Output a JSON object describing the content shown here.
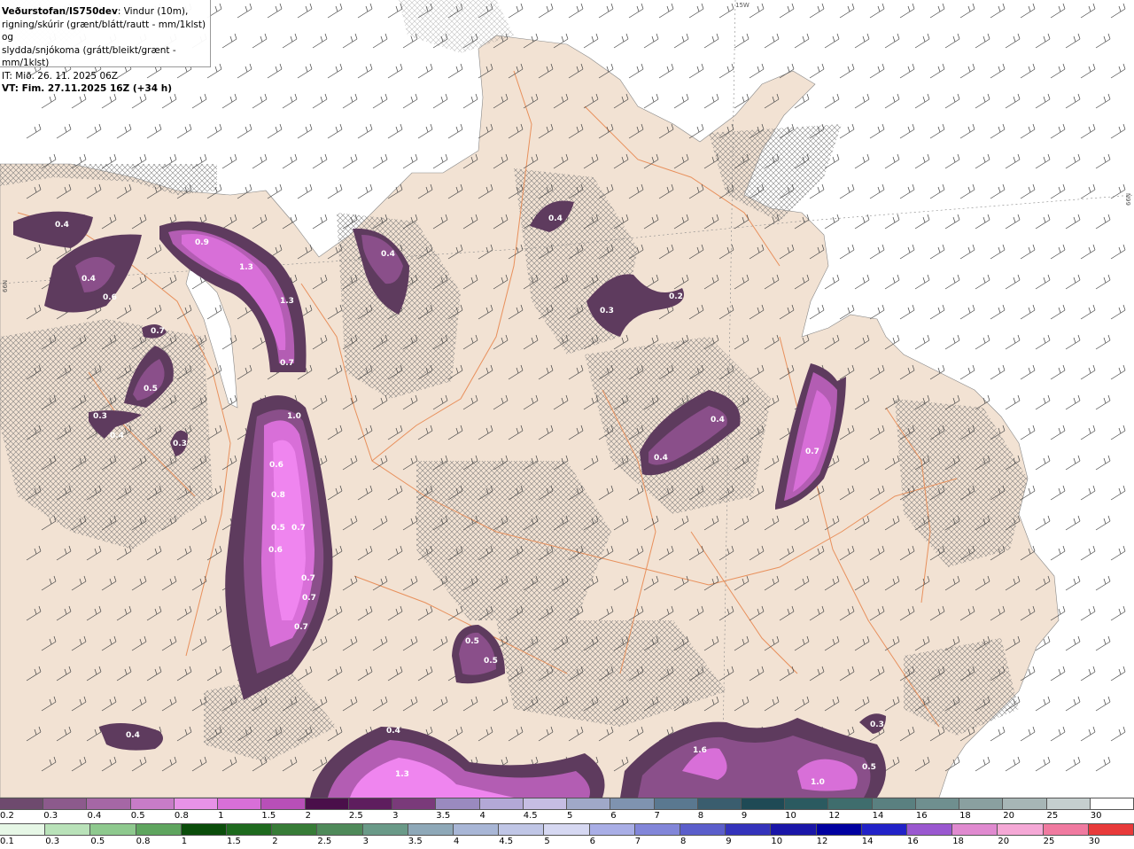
{
  "title": {
    "source": "Veðurstofan/IS750dev",
    "desc1": ": Vindur (10m),",
    "desc2": "rigning/skúrir (grænt/blátt/rautt - mm/1klst) og",
    "desc3": "slydda/snjókoma (grátt/bleikt/grænt - mm/1klst)",
    "it": "IT: Mið. 26. 11. 2025 06Z",
    "vt": "VT: Fim. 27.11.2025 16Z (+34 h)"
  },
  "grid_labels": [
    "15W",
    "66N",
    "66N"
  ],
  "colors": {
    "sea": "#ffffff",
    "land": "#f2e2d3",
    "roads": "#e8905c",
    "snow_shade": [
      "#5e3b5e",
      "#8a4f8a",
      "#b35db3",
      "#d86fd8",
      "#ef85ef"
    ]
  },
  "precip_labels": [
    "0.4",
    "0.4",
    "0.6",
    "0.9",
    "1.3",
    "1.3",
    "0.7",
    "0.4",
    "0.4",
    "0.3",
    "0.2",
    "0.7",
    "0.5",
    "0.3",
    "0.4",
    "0.3",
    "1.0",
    "0.6",
    "0.8",
    "0.5",
    "0.7",
    "0.6",
    "0.7",
    "0.7",
    "0.7",
    "0.4",
    "0.4",
    "0.7",
    "0.5",
    "0.5",
    "0.4",
    "0.3",
    "0.4",
    "1.3",
    "1.6",
    "1.0",
    "0.5"
  ],
  "legend_snow": {
    "labels": [
      "0.2",
      "0.3",
      "0.4",
      "0.5",
      "0.8",
      "1",
      "1.5",
      "2",
      "2.5",
      "3",
      "3.5",
      "4",
      "4.5",
      "5",
      "6",
      "7",
      "8",
      "9",
      "10",
      "12",
      "14",
      "16",
      "18",
      "20",
      "25",
      "30"
    ],
    "colors": [
      "#6e4a6e",
      "#8c5a8c",
      "#a567a5",
      "#c77cc7",
      "#e792e7",
      "#d86fd8",
      "#b84fb8",
      "#4a0f4a",
      "#5e1d5e",
      "#7a3a7a",
      "#9a8abf",
      "#b3a8d6",
      "#c6bde3",
      "#a0a8c8",
      "#7f93b0",
      "#5a7890",
      "#3a5d6e",
      "#1f4a55",
      "#2b5a60",
      "#3f6d6d",
      "#5a8080",
      "#6f8f8f",
      "#8aa0a0",
      "#a7b6b6",
      "#c5cfcf",
      "#ffffff"
    ]
  },
  "legend_rain": {
    "labels": [
      "0.1",
      "0.3",
      "0.5",
      "0.8",
      "1",
      "1.5",
      "2",
      "2.5",
      "3",
      "3.5",
      "4",
      "4.5",
      "5",
      "6",
      "7",
      "8",
      "9",
      "10",
      "12",
      "14",
      "16",
      "18",
      "20",
      "25",
      "30"
    ],
    "colors": [
      "#e6f7e6",
      "#b9e2b9",
      "#8ec98e",
      "#5fa55f",
      "#0b4d0b",
      "#1e6a1e",
      "#377c37",
      "#4f8a5a",
      "#6a9a88",
      "#8ea8b8",
      "#a8b6d6",
      "#c0c6e6",
      "#d6d8f2",
      "#a9aee6",
      "#8286d9",
      "#5b5ecb",
      "#3433bb",
      "#1a16a8",
      "#0000a0",
      "#2222c8",
      "#9a58d0",
      "#e08ad0",
      "#f5a8d6",
      "#f07aa0",
      "#e83a3a"
    ]
  }
}
